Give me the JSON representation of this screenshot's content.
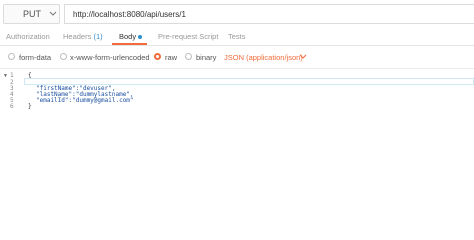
{
  "request": {
    "method": "PUT",
    "url": "http://localhost:8080/api/users/1"
  },
  "tabs": [
    {
      "label": "Authorization"
    },
    {
      "label": "Headers",
      "count": "(1)"
    },
    {
      "label": "Body"
    },
    {
      "label": "Pre-request Script"
    },
    {
      "label": "Tests"
    }
  ],
  "body_options": [
    {
      "label": "form-data",
      "selected": false
    },
    {
      "label": "x-www-form-urlencoded",
      "selected": false
    },
    {
      "label": "raw",
      "selected": true
    },
    {
      "label": "binary",
      "selected": false
    }
  ],
  "format": "JSON (application/json)",
  "editor": {
    "line_numbers": [
      "1",
      "2",
      "3",
      "4",
      "5",
      "6"
    ],
    "lines": [
      "{",
      "",
      "\"firstName\":\"devuser\",",
      "\"lastName\":\"dummylastname\",",
      "\"emailId\":\"dummy@gmail.com\"",
      "}"
    ]
  },
  "colors": {
    "accent": "#f26b3a",
    "link": "#2e90cf"
  }
}
